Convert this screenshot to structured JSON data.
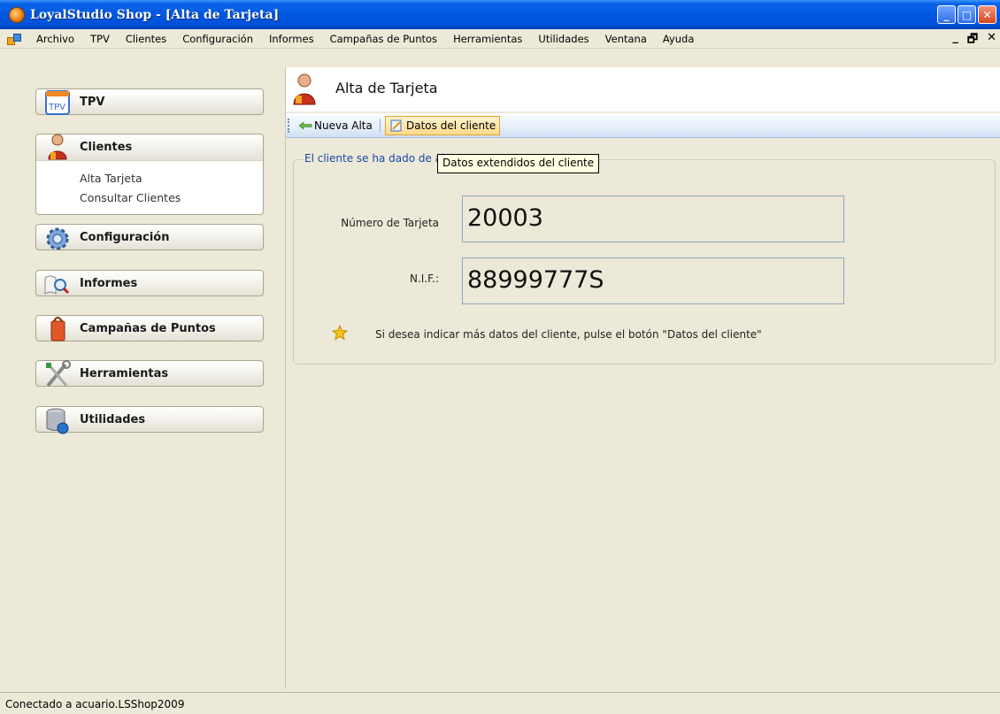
{
  "window": {
    "title": "LoyalStudio Shop - [Alta de Tarjeta]"
  },
  "menu": {
    "items": [
      "Archivo",
      "TPV",
      "Clientes",
      "Configuración",
      "Informes",
      "Campañas de Puntos",
      "Herramientas",
      "Utilidades",
      "Ventana",
      "Ayuda"
    ]
  },
  "nav": {
    "groups": [
      {
        "label": "TPV"
      },
      {
        "label": "Clientes",
        "items": [
          "Alta Tarjeta",
          "Consultar Clientes"
        ]
      },
      {
        "label": "Configuración"
      },
      {
        "label": "Informes"
      },
      {
        "label": "Campañas de Puntos"
      },
      {
        "label": "Herramientas"
      },
      {
        "label": "Utilidades"
      }
    ]
  },
  "content": {
    "header_title": "Alta de Tarjeta",
    "toolbar": {
      "new_label": "Nueva Alta",
      "data_label": "Datos del cliente"
    },
    "group_caption": "El cliente se ha dado de al",
    "tooltip": "Datos extendidos del cliente",
    "fields": {
      "card_label": "Número de Tarjeta",
      "card_value": "20003",
      "nif_label": "N.I.F.:",
      "nif_value": "88999777S"
    },
    "hint": "Si desea indicar más datos del cliente, pulse el botón \"Datos del cliente\""
  },
  "status": {
    "text": "Conectado a acuario.LSShop2009"
  }
}
